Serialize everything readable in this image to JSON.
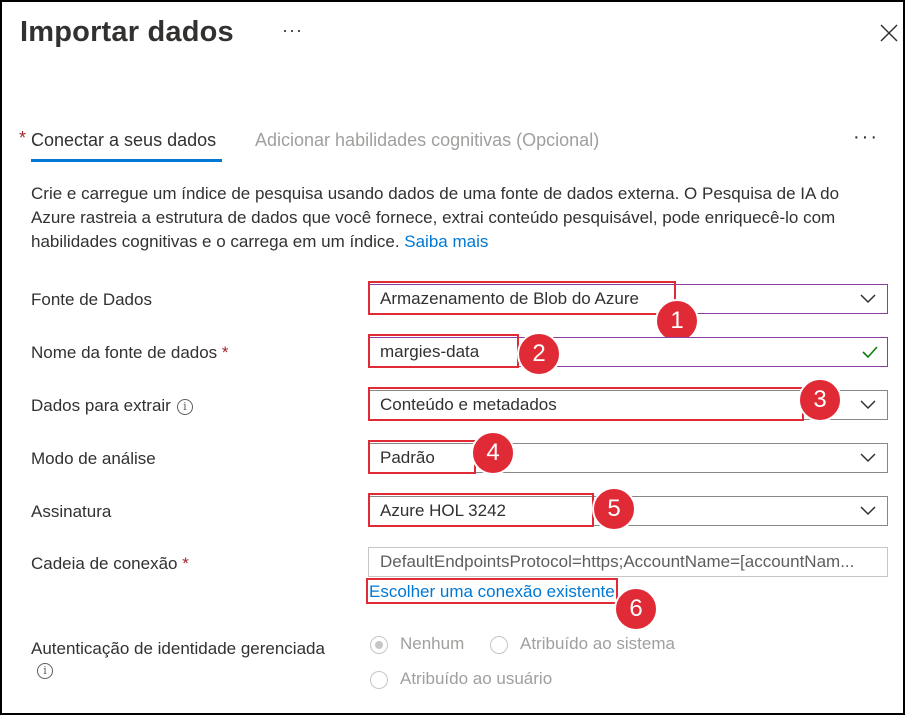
{
  "header": {
    "title": "Importar dados",
    "more": "···"
  },
  "tabs": [
    {
      "label": "Conectar a seus dados",
      "required": "*"
    },
    {
      "label": "Adicionar habilidades cognitivas (Opcional)"
    }
  ],
  "tabs_more": "···",
  "description": {
    "text": "Crie e carregue um índice de pesquisa usando dados de uma fonte de dados externa. O Pesquisa de IA do Azure rastreia a estrutura de dados que você fornece, extrai conteúdo pesquisável, pode enriquecê-lo com habilidades cognitivas e o carrega em um índice. ",
    "link": "Saiba mais"
  },
  "form": {
    "data_source": {
      "label": "Fonte de Dados",
      "value": "Armazenamento de Blob do Azure"
    },
    "data_source_name": {
      "label": "Nome da fonte de dados",
      "required": "*",
      "value": "margies-data"
    },
    "data_to_extract": {
      "label": "Dados para extrair",
      "info": "i",
      "value": "Conteúdo e metadados"
    },
    "parsing_mode": {
      "label": "Modo de análise",
      "value": "Padrão"
    },
    "subscription": {
      "label": "Assinatura",
      "value": "Azure HOL 3242"
    },
    "connection_string": {
      "label": "Cadeia de conexão",
      "required": "*",
      "placeholder": "DefaultEndpointsProtocol=https;AccountName=[accountNam...",
      "link": "Escolher uma conexão existente"
    },
    "managed_identity": {
      "label": "Autenticação de identidade gerenciada",
      "info": "i",
      "options": [
        "Nenhum",
        "Atribuído ao sistema",
        "Atribuído ao usuário"
      ],
      "selected": "Nenhum"
    }
  },
  "callouts": [
    "1",
    "2",
    "3",
    "4",
    "5",
    "6"
  ],
  "colors": {
    "accent": "#0078d4",
    "callout": "#e02a36",
    "required": "#a4262c",
    "valid": "#107c10"
  }
}
